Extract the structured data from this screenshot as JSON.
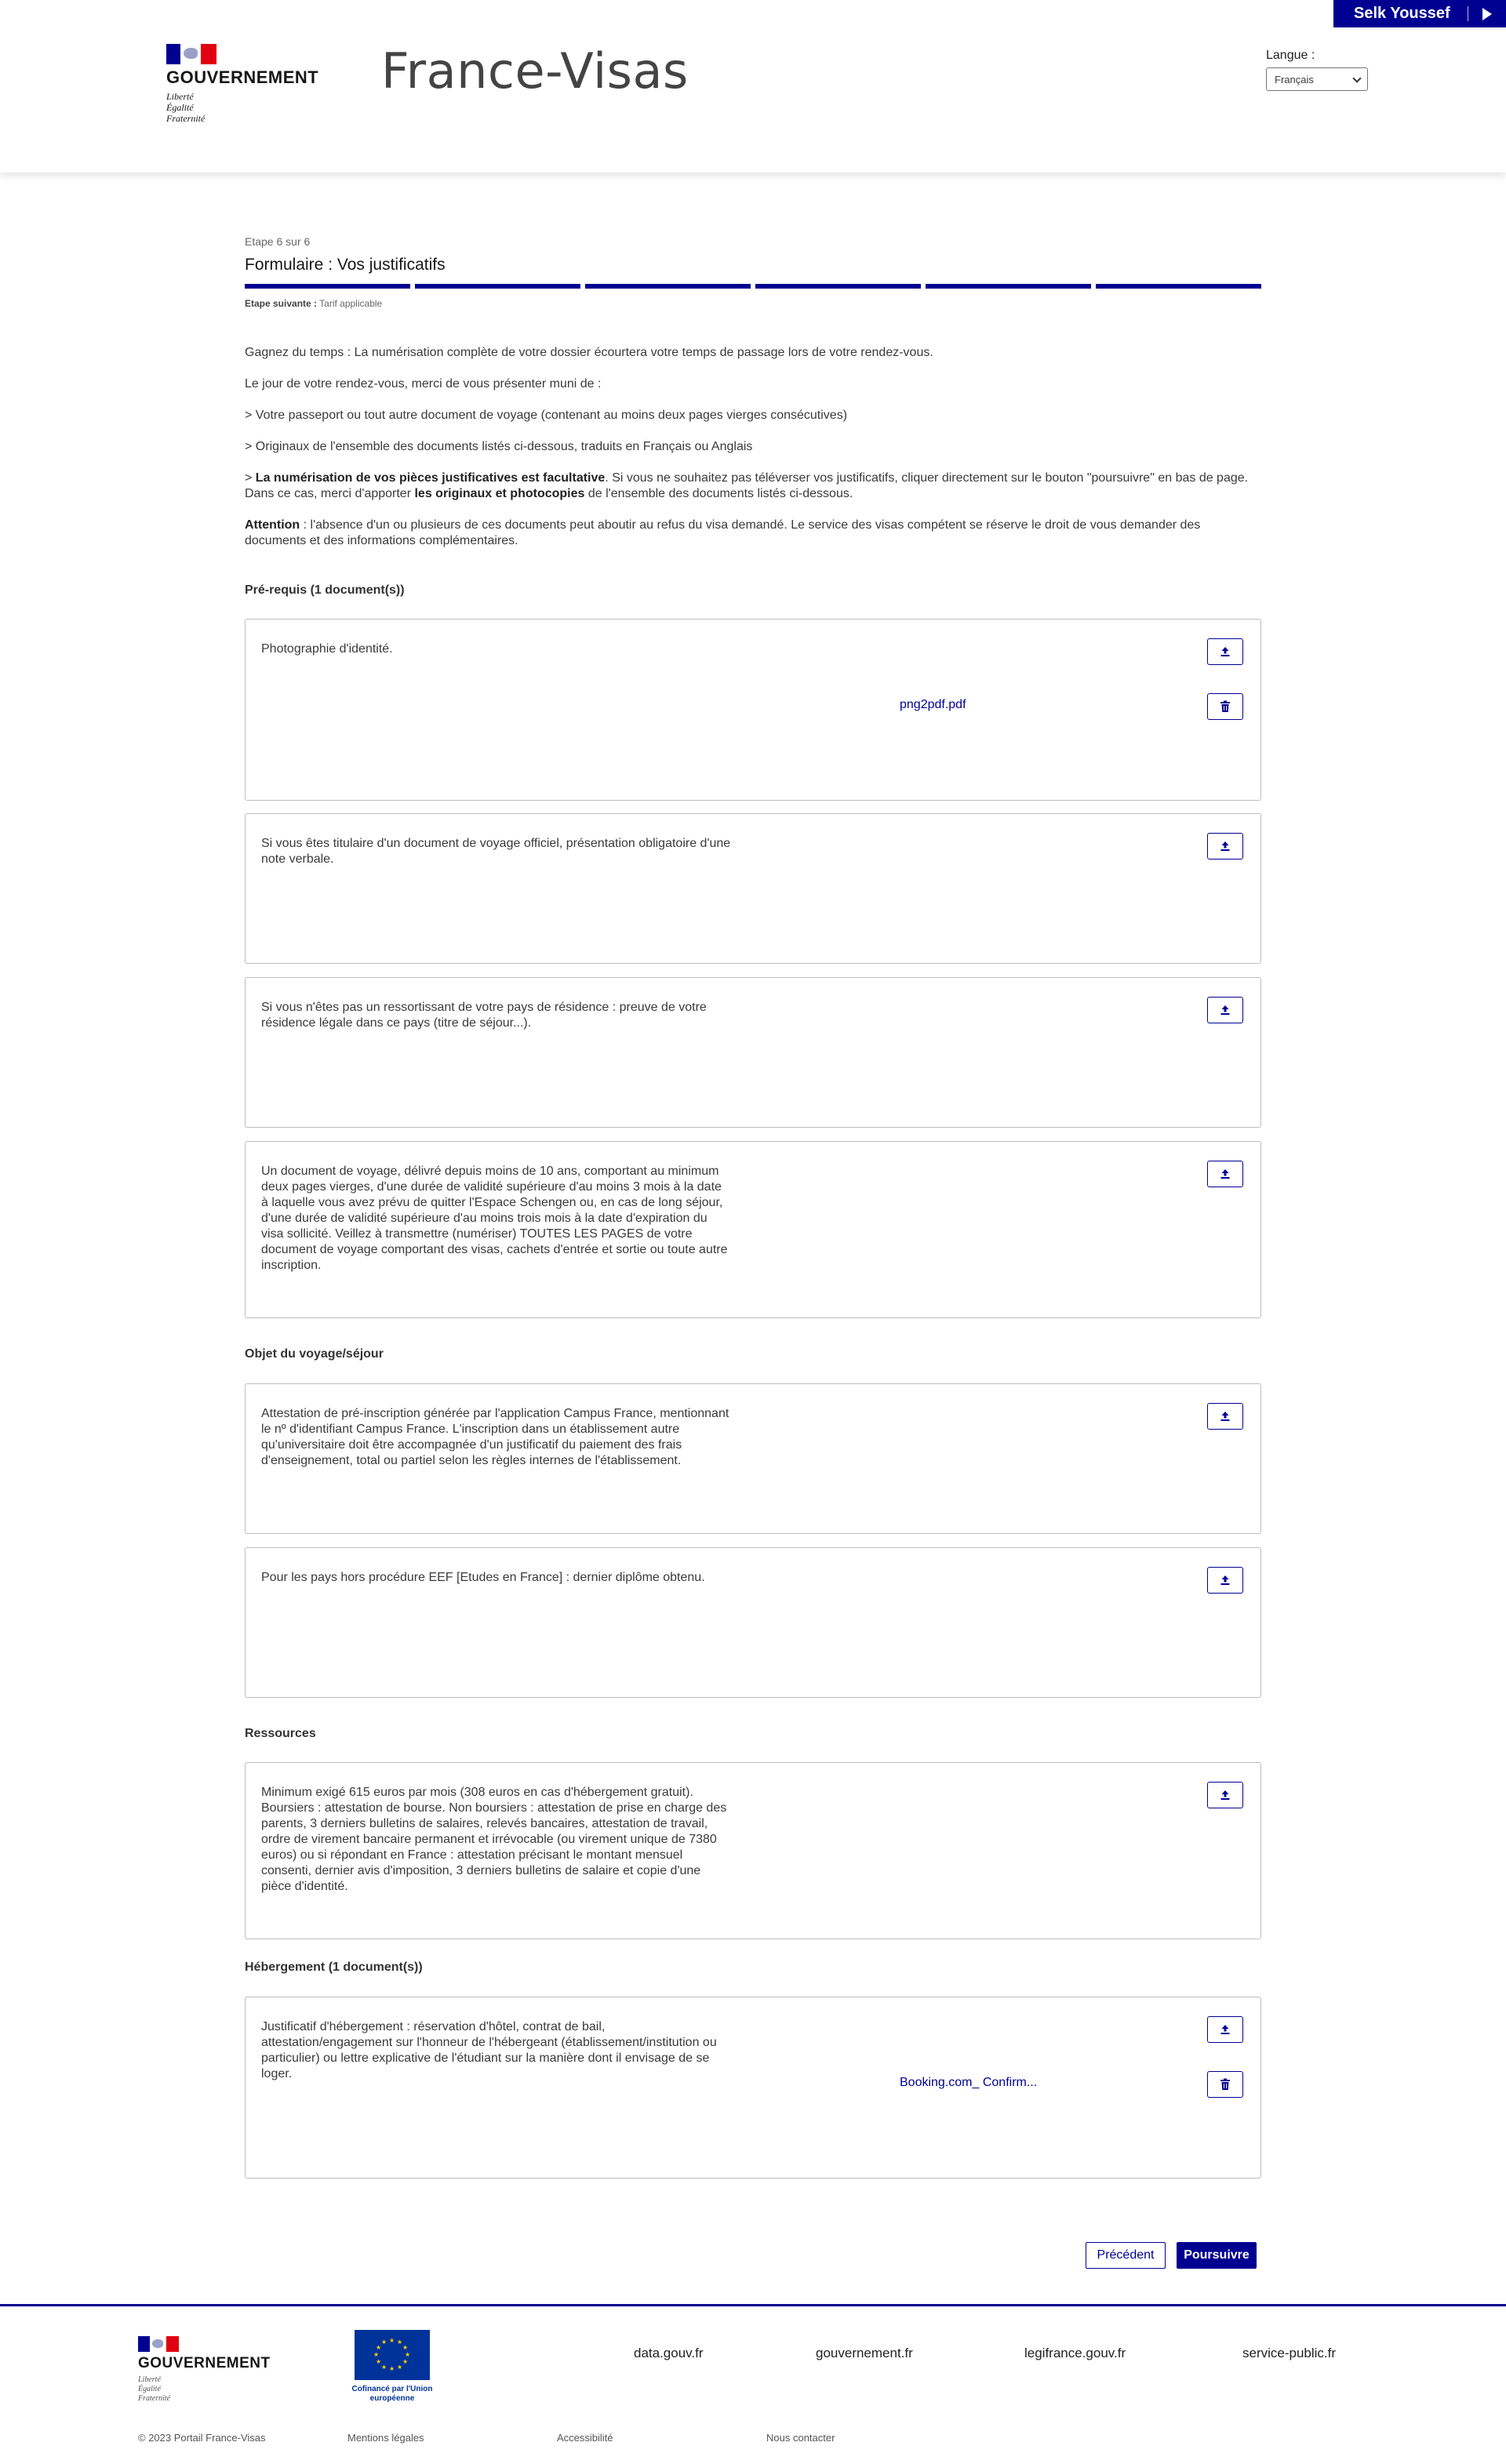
{
  "header": {
    "user_name": "Selk Youssef",
    "gov_name": "GOUVERNEMENT",
    "devise": [
      "Liberté",
      "Égalité",
      "Fraternité"
    ],
    "site_title": "France-Visas",
    "lang_label": "Langue :",
    "lang_value": "Français"
  },
  "step": {
    "info": "Etape 6 sur 6",
    "title": "Formulaire : Vos justificatifs",
    "next_label": "Etape suivante :",
    "next_value": "Tarif applicable",
    "progress_completed": 6,
    "progress_total": 6
  },
  "intro": {
    "p1": "Gagnez du temps : La numérisation complète de votre dossier écourtera votre temps de passage lors de votre rendez-vous.",
    "p2": "Le jour de votre rendez-vous, merci de vous présenter muni de :",
    "p3": "> Votre passeport ou tout autre document de voyage (contenant au moins deux pages vierges consécutives)",
    "p4": "> Originaux de l'ensemble des documents listés ci-dessous, traduits en Français ou Anglais",
    "p5_prefix": "> ",
    "p5_bold": "La numérisation de vos pièces justificatives est facultative",
    "p5_mid": ". Si vous ne souhaitez pas téléverser vos justificatifs, cliquer directement sur le bouton \"poursuivre\" en bas de page. Dans ce cas, merci d'apporter ",
    "p5_bold2": "les originaux et photocopies",
    "p5_end": " de l'ensemble des documents listés ci-dessous.",
    "att_bold": "Attention",
    "att_text": " : l'absence d'un ou plusieurs de ces documents peut aboutir au refus du visa demandé. Le service des visas compétent se réserve le droit de vous demander des documents et des informations complémentaires."
  },
  "sections": {
    "prerequis": "Pré-requis (1 document(s))",
    "objet": "Objet du voyage/séjour",
    "ressources": "Ressources",
    "hebergement": "Hébergement (1 document(s))"
  },
  "documents": {
    "photo": {
      "text": "Photographie d'identité.",
      "file": "png2pdf.pdf"
    },
    "note_verbale": {
      "text": "Si vous êtes titulaire d'un document de voyage officiel, présentation obligatoire d'une note verbale."
    },
    "residence": {
      "text": "Si vous n'êtes pas un ressortissant de votre pays de résidence : preuve de votre résidence légale dans ce pays (titre de séjour...)."
    },
    "passport": {
      "text": "Un document de voyage, délivré depuis moins de 10 ans, comportant au minimum deux pages vierges, d'une durée de validité supérieure d'au moins 3 mois à la date à laquelle vous avez prévu de quitter l'Espace Schengen ou, en cas de long séjour, d'une durée de validité supérieure d'au moins trois mois à la date d'expiration du visa sollicité. Veillez à transmettre (numériser) TOUTES LES PAGES de votre document de voyage comportant des visas, cachets d'entrée et sortie ou toute autre inscription."
    },
    "campus": {
      "text": "Attestation de pré-inscription générée par l'application Campus France, mentionnant le nº d'identifiant Campus France. L'inscription dans un établissement autre qu'universitaire doit être accompagnée d'un justificatif du paiement des frais d'enseignement, total ou partiel selon les règles internes de l'établissement."
    },
    "diplome": {
      "text": "Pour les pays hors procédure EEF [Etudes en France] : dernier diplôme obtenu."
    },
    "ressources": {
      "text": "Minimum exigé 615 euros par mois (308 euros en cas d'hébergement gratuit). Boursiers : attestation de bourse. Non boursiers : attestation de prise en charge des parents, 3 derniers bulletins de salaires, relevés bancaires, attestation de travail, ordre de virement bancaire permanent et irrévocable (ou virement unique de 7380 euros) ou si répondant en France : attestation précisant le montant mensuel consenti, dernier avis d'imposition, 3 derniers bulletins de salaire et copie d'une pièce d'identité."
    },
    "hebergement": {
      "text": "Justificatif d'hébergement : réservation d'hôtel, contrat de bail, attestation/engagement sur l'honneur de l'hébergeant (établissement/institution ou particulier) ou lettre explicative de l'étudiant sur la manière dont il envisage de se loger.",
      "file": "Booking.com_ Confirm..."
    }
  },
  "icons": {
    "upload": "upload-icon",
    "delete": "trash-icon"
  },
  "buttons": {
    "previous": "Précédent",
    "continue": "Poursuivre"
  },
  "footer": {
    "eu_text": "Cofinancé par l'Union européenne",
    "links": [
      "data.gouv.fr",
      "gouvernement.fr",
      "legifrance.gouv.fr",
      "service-public.fr"
    ],
    "copyright": "© 2023 Portail France-Visas",
    "bottom_links": [
      "Mentions légales",
      "Accessibilité",
      "Nous contacter"
    ]
  },
  "colors": {
    "primary": "#000091",
    "red": "#e1000f",
    "eu_blue": "#003399",
    "eu_gold": "#ffcc00"
  }
}
